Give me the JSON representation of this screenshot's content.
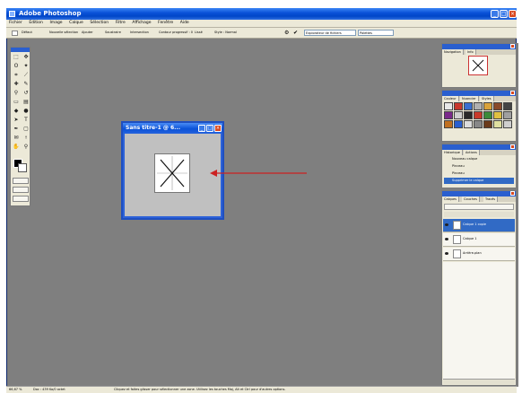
{
  "app": {
    "title": "Adobe Photoshop"
  },
  "menu": [
    "Fichier",
    "Edition",
    "Image",
    "Calque",
    "Sélection",
    "Filtre",
    "Affichage",
    "Fenêtre",
    "Aide"
  ],
  "options_bar": {
    "items": [
      "Défaut",
      "Nouvelle sélection",
      "Ajouter",
      "Soustraire",
      "Intersection",
      "Contour progressif : 0 px",
      "Lissé",
      "Style : Normal"
    ],
    "fields": [
      "Explorateur de fichiers",
      "Palettes"
    ]
  },
  "document": {
    "title": "Sans titre-1 @ 6..."
  },
  "panels": {
    "navigator": {
      "tabs": [
        "Navigation",
        "Info"
      ]
    },
    "styles": {
      "tabs": [
        "Couleur",
        "Nuancier",
        "Styles"
      ]
    },
    "history": {
      "tabs": [
        "Historique",
        "Actions"
      ],
      "items": [
        "Nouveau calque",
        "Pinceau",
        "Pinceau",
        "Supprimer le calque"
      ]
    },
    "layers": {
      "tabs": [
        "Calques",
        "Couches",
        "Tracés"
      ],
      "items": [
        "Calque 1 copie",
        "Calque 1",
        "Arrière-plan"
      ]
    }
  },
  "status_bar": {
    "zoom": "66,67 %",
    "doc": "Doc : 439 Ko/0 octet",
    "hint": "Cliquez et faites glisser pour sélectionner une zone. Utilisez les touches Maj, Alt et Ctrl pour d'autres options."
  },
  "colors": {
    "workspace": "#7f7f7f",
    "accent": "#0a52d8",
    "arrow": "#cc2222"
  }
}
